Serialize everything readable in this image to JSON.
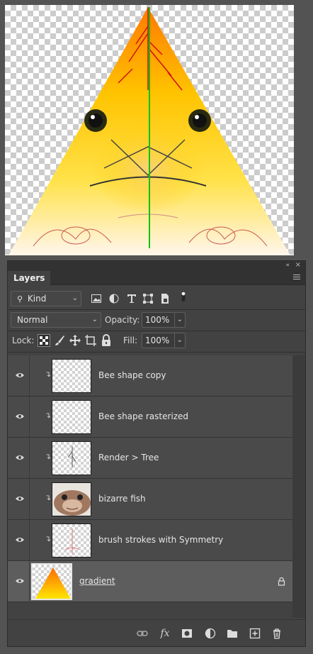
{
  "panel": {
    "tab_label": "Layers",
    "collapse_glyph": "«",
    "close_glyph": "×"
  },
  "filter": {
    "kind_label": "Kind",
    "icons": [
      "image-filter-icon",
      "adjustment-filter-icon",
      "type-filter-icon",
      "shape-filter-icon",
      "smart-object-filter-icon",
      "filter-toggle-icon"
    ]
  },
  "blend": {
    "mode": "Normal",
    "opacity_label": "Opacity:",
    "opacity_value": "100%"
  },
  "lock": {
    "lock_label": "Lock:",
    "fill_label": "Fill:",
    "fill_value": "100%"
  },
  "layers": [
    {
      "name": "Bee shape copy",
      "visible": true,
      "clipped": true
    },
    {
      "name": "Bee shape rasterized",
      "visible": true,
      "clipped": true
    },
    {
      "name": "Render > Tree",
      "visible": true,
      "clipped": true
    },
    {
      "name": "bizarre fish",
      "visible": true,
      "clipped": true
    },
    {
      "name": "brush strokes with Symmetry",
      "visible": true,
      "clipped": true
    },
    {
      "name": "gradient",
      "visible": true,
      "clipped": false,
      "locked": true,
      "selected": true
    }
  ],
  "footer_icons": [
    "link-layers-icon",
    "fx-icon",
    "add-mask-icon",
    "adjustment-layer-icon",
    "new-group-icon",
    "new-layer-icon",
    "delete-layer-icon"
  ],
  "footer_fx_label": "fx",
  "colors": {
    "panel_bg": "#424242",
    "selected_row": "#5d5d5d",
    "gradient_top": "#ff6a00",
    "gradient_bottom": "#ffe600"
  }
}
